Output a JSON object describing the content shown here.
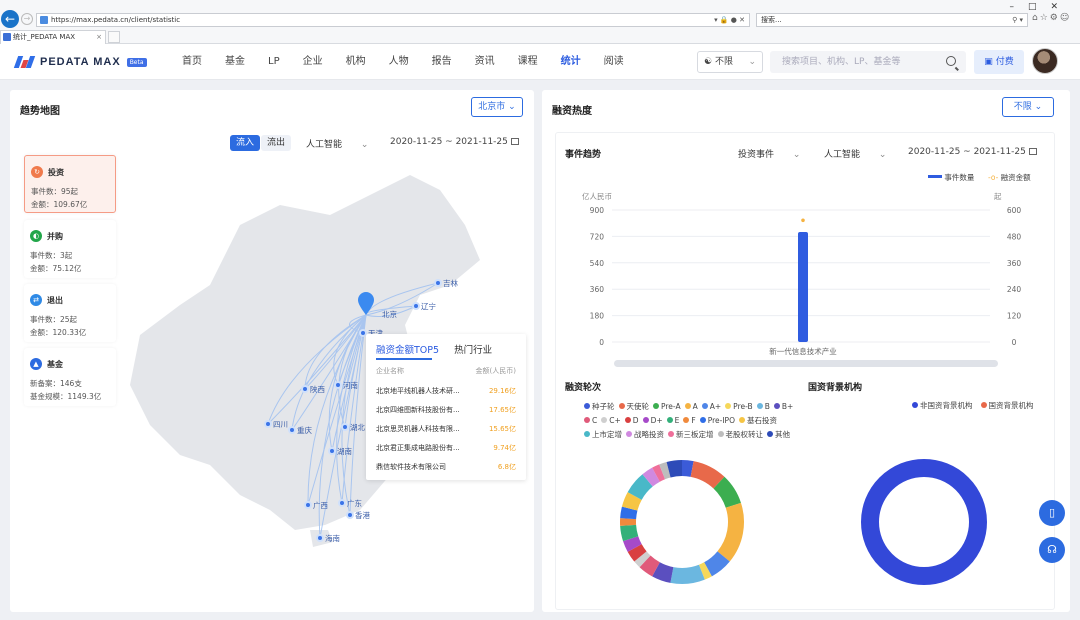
{
  "browser": {
    "url": "https://max.pedata.cn/client/statistic",
    "search_placeholder": "搜索...",
    "tab_title": "统计_PEDATA MAX"
  },
  "nav": {
    "logo_text": "PEDATA MAX",
    "beta": "Beta",
    "items": [
      "首页",
      "基金",
      "LP",
      "企业",
      "机构",
      "人物",
      "报告",
      "资讯",
      "课程",
      "统计",
      "阅读"
    ],
    "active_item": "统计",
    "filter_label": "不限",
    "search_placeholder": "搜索项目、机构、LP、基金等",
    "pay_label": "付费"
  },
  "trend_map": {
    "title": "趋势地图",
    "region": "北京市",
    "toggle_in": "流入",
    "toggle_out": "流出",
    "industry": "人工智能",
    "date_range": "2020-11-25 ~ 2021-11-25",
    "cards": [
      {
        "name": "投资",
        "line1": "事件数：95起",
        "line2": "金额：109.67亿",
        "color": "#f07a4c"
      },
      {
        "name": "并购",
        "line1": "事件数：3起",
        "line2": "金额：75.12亿",
        "color": "#22a64a"
      },
      {
        "name": "退出",
        "line1": "事件数：25起",
        "line2": "金额：120.33亿",
        "color": "#2f8ae6"
      },
      {
        "name": "基金",
        "line1": "新备案：146支",
        "line2": "基金规模：1149.3亿",
        "color": "#2c6be0"
      }
    ],
    "map_labels": {
      "beijing": "北京",
      "jilin": "吉林",
      "liaoning": "辽宁",
      "tianjin": "天津",
      "shaanxi": "陕西",
      "henan": "河南",
      "sichuan": "四川",
      "chongqing": "重庆",
      "hubei": "湖北",
      "hunan": "湖南",
      "guangxi": "广西",
      "guangdong": "广东",
      "hongkong": "香港",
      "hainan": "海南"
    },
    "top5": {
      "tab_active": "融资金额TOP5",
      "tab_other": "热门行业",
      "col_name": "企业名称",
      "col_amount": "金额(人民币)",
      "rows": [
        {
          "name": "北京地平线机器人技术研...",
          "amount": "29.16亿"
        },
        {
          "name": "北京四维图新科技股份有...",
          "amount": "17.65亿"
        },
        {
          "name": "北京思灵机器人科技有限...",
          "amount": "15.65亿"
        },
        {
          "name": "北京君正集成电路股份有...",
          "amount": "9.74亿"
        },
        {
          "name": "鼎信软件技术有限公司",
          "amount": "6.8亿"
        }
      ]
    }
  },
  "financing": {
    "title": "融资热度",
    "filter": "不限",
    "event_trend": {
      "title": "事件趋势",
      "event_type": "投资事件",
      "industry": "人工智能",
      "date_range": "2020-11-25 ~ 2021-11-25",
      "legend_count": "事件数量",
      "legend_amount": "融资金额",
      "left_unit": "亿人民币",
      "right_unit": "起"
    },
    "rounds": {
      "title": "融资轮次",
      "legend": [
        {
          "name": "种子轮",
          "color": "#3b5bd8"
        },
        {
          "name": "天使轮",
          "color": "#e8694a"
        },
        {
          "name": "Pre-A",
          "color": "#3cae50"
        },
        {
          "name": "A",
          "color": "#f5b342"
        },
        {
          "name": "A+",
          "color": "#4f86e8"
        },
        {
          "name": "Pre-B",
          "color": "#f6d85a"
        },
        {
          "name": "B",
          "color": "#6bb7e0"
        },
        {
          "name": "B+",
          "color": "#5b4fbf"
        },
        {
          "name": "C",
          "color": "#e05a7a"
        },
        {
          "name": "C+",
          "color": "#cfcfcf"
        },
        {
          "name": "D",
          "color": "#d94040"
        },
        {
          "name": "D+",
          "color": "#a64ac9"
        },
        {
          "name": "E",
          "color": "#33b07a"
        },
        {
          "name": "F",
          "color": "#f08a3c"
        },
        {
          "name": "Pre-IPO",
          "color": "#2f6ee8"
        },
        {
          "name": "基石投资",
          "color": "#f6c544"
        },
        {
          "name": "上市定增",
          "color": "#49b8c8"
        },
        {
          "name": "战略投资",
          "color": "#d089e0"
        },
        {
          "name": "新三板定增",
          "color": "#ef6f9a"
        },
        {
          "name": "老股权转让",
          "color": "#bdbdbd"
        },
        {
          "name": "其他",
          "color": "#2d4bb8"
        }
      ]
    },
    "state_background": {
      "title": "国资背景机构",
      "legend": [
        {
          "name": "非国资背景机构",
          "color": "#3348d8"
        },
        {
          "name": "国资背景机构",
          "color": "#e8694a"
        }
      ]
    }
  },
  "chart_data": {
    "type": "bar",
    "categories": [
      "新一代信息技术产业"
    ],
    "y_left": {
      "label": "亿人民币",
      "ticks": [
        0,
        180,
        360,
        540,
        720,
        900
      ]
    },
    "y_right": {
      "label": "起",
      "ticks": [
        0,
        120,
        240,
        360,
        480,
        600
      ]
    },
    "series": [
      {
        "name": "事件数量",
        "type": "bar",
        "axis": "right",
        "values": [
          500
        ],
        "color": "#2f5ce0"
      },
      {
        "name": "融资金额",
        "type": "line",
        "axis": "left",
        "values": [
          830
        ],
        "color": "#f5b342"
      }
    ]
  }
}
